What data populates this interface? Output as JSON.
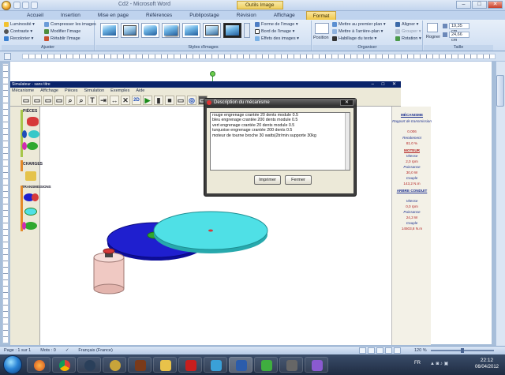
{
  "word": {
    "window_title": "Cd2 - Microsoft Word",
    "context_tools": "Outils Image",
    "tabs": [
      {
        "label": "Accueil"
      },
      {
        "label": "Insertion"
      },
      {
        "label": "Mise en page"
      },
      {
        "label": "Références"
      },
      {
        "label": "Publipostage"
      },
      {
        "label": "Révision"
      },
      {
        "label": "Affichage"
      },
      {
        "label": "Format",
        "active": true
      }
    ],
    "ribbon": {
      "adjust": {
        "label": "Ajuster",
        "items": [
          "Luminosité ▾",
          "Contraste ▾",
          "Recolorier ▾",
          "Compresser les images",
          "Modifier l'image",
          "Rétablir l'image"
        ]
      },
      "styles": {
        "label": "Styles d'images",
        "items": [
          "Forme de l'image ▾",
          "Bord de l'image ▾",
          "Effets des images ▾"
        ]
      },
      "arrange": {
        "label": "Organiser",
        "position": "Position",
        "items": [
          "Mettre au premier plan ▾",
          "Mettre à l'arrière-plan ▾",
          "Habillage du texte ▾",
          "Aligner ▾",
          "Grouper ▾",
          "Rotation ▾"
        ]
      },
      "size": {
        "label": "Taille",
        "crop": "Rogner",
        "height": "19,35 cm",
        "width": "24,66 cm"
      }
    },
    "status": {
      "page": "Page : 1 sur 1",
      "words": "Mots : 0",
      "language": "Français (France)",
      "zoom": "120 %"
    }
  },
  "simulator": {
    "title": "Simulateur - sans titre",
    "menu": [
      "Mécanisme",
      "Affichage",
      "Pièces",
      "Simulation",
      "Exemples",
      "Aide"
    ],
    "toolbar_glyphs": [
      "▭",
      "▭",
      "▭",
      "▭",
      "⌕",
      "⌕",
      "T",
      "⇥",
      "↔",
      "✕",
      "2D",
      "▶",
      "▮",
      "■",
      "▭",
      "◎",
      "▭"
    ],
    "palette": {
      "pieces": "PIÈCES",
      "charges": "CHARGES",
      "transmissions": "TRANSMISSIONS"
    },
    "panel": {
      "mecanisme": {
        "head": "MÉCANISME",
        "lines": [
          {
            "label": "Rapport de transmission",
            "value": "0.006"
          },
          {
            "label": "Rendement",
            "value": "81.0 %"
          }
        ]
      },
      "moteur": {
        "head": "MOTEUR",
        "lines": [
          {
            "label": "Vitesse",
            "value": "2,0 rpm"
          },
          {
            "label": "Puissance",
            "value": "30,0 W"
          },
          {
            "label": "Couple",
            "value": "143,2 N.m"
          }
        ]
      },
      "arbre": {
        "head": "ARBRE CONDUIT",
        "lines": [
          {
            "label": "Vitesse",
            "value": "0,0 rpm"
          },
          {
            "label": "Puissance",
            "value": "24,3 W"
          },
          {
            "label": "Couple",
            "value": "14503,8 N.m"
          }
        ]
      }
    }
  },
  "dialog": {
    "title": "Description du mécanisme",
    "lines": [
      "rouge engrenage crantée 20 dents module 0.5",
      "bleu engrenage crantée 200 dents module 0.5",
      "vert engrenage crantée 20 dents module 0.5",
      "turquoise engrenage crantée 200 dents 0.5",
      "moteur de tourne broche 30 watts|2tr/min supporte 30kg"
    ],
    "print": "Imprimer",
    "close": "Fermer"
  },
  "taskbar": {
    "language": "FR",
    "time": "22:12",
    "date": "06/04/2012"
  },
  "colors": {
    "accent": "#f1c845",
    "gear_red": "#d63a3a",
    "gear_blue": "#1f1fcf",
    "gear_turquoise": "#4fe0e6",
    "gear_green": "#2fa82f"
  }
}
